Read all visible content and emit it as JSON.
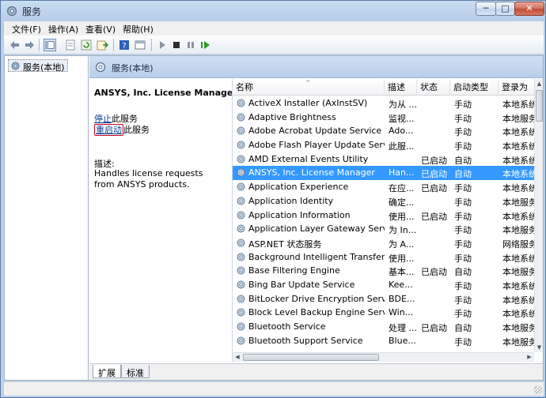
{
  "window": {
    "title": "服务"
  },
  "caption_buttons": {
    "minimize": "─",
    "maximize": "□",
    "close": "✕"
  },
  "menu": [
    {
      "label": "文件(F)"
    },
    {
      "label": "操作(A)"
    },
    {
      "label": "查看(V)"
    },
    {
      "label": "帮助(H)"
    }
  ],
  "toolbar": {
    "icons": [
      "back-arrow-icon",
      "forward-arrow-icon",
      "console-tree-icon",
      "properties-icon",
      "refresh-icon",
      "export-icon",
      "help-icon",
      "show-hide-icon",
      "play-icon",
      "stop-icon",
      "pause-icon",
      "restart-icon"
    ]
  },
  "tree": {
    "root_label": "服务(本地)"
  },
  "header": {
    "title": "服务(本地)"
  },
  "detail": {
    "service_title": "ANSYS, Inc. License Manager",
    "stop_link": "停止",
    "stop_suffix": "此服务",
    "restart_link": "重启动",
    "restart_suffix": "此服务",
    "desc_label": "描述:",
    "desc_text": "Handles license requests from ANSYS products."
  },
  "columns": {
    "name": "名称",
    "description": "描述",
    "status": "状态",
    "startup": "启动类型",
    "logon": "登录为"
  },
  "sort_indicator": "^",
  "services": [
    {
      "name": "ActiveX Installer (AxInstSV)",
      "desc": "为从 ...",
      "status": "",
      "startup": "手动",
      "logon": "本地系统"
    },
    {
      "name": "Adaptive Brightness",
      "desc": "监视...",
      "status": "",
      "startup": "手动",
      "logon": "本地服务"
    },
    {
      "name": "Adobe Acrobat Update Service",
      "desc": "Ado...",
      "status": "",
      "startup": "手动",
      "logon": "本地系统"
    },
    {
      "name": "Adobe Flash Player Update Servi...",
      "desc": "此服...",
      "status": "",
      "startup": "手动",
      "logon": "本地系统"
    },
    {
      "name": "AMD External Events Utility",
      "desc": "",
      "status": "已启动",
      "startup": "自动",
      "logon": "本地系统"
    },
    {
      "name": "ANSYS, Inc. License Manager",
      "desc": "Han...",
      "status": "已启动",
      "startup": "自动",
      "logon": "本地系统",
      "selected": true
    },
    {
      "name": "Application Experience",
      "desc": "在应...",
      "status": "已启动",
      "startup": "手动",
      "logon": "本地系统"
    },
    {
      "name": "Application Identity",
      "desc": "确定...",
      "status": "",
      "startup": "手动",
      "logon": "本地服务"
    },
    {
      "name": "Application Information",
      "desc": "使用...",
      "status": "已启动",
      "startup": "手动",
      "logon": "本地系统"
    },
    {
      "name": "Application Layer Gateway Service",
      "desc": "为 In...",
      "status": "",
      "startup": "手动",
      "logon": "本地服务"
    },
    {
      "name": "ASP.NET 状态服务",
      "desc": "为 A...",
      "status": "",
      "startup": "手动",
      "logon": "网络服务"
    },
    {
      "name": "Background Intelligent Transfer ...",
      "desc": "使用...",
      "status": "",
      "startup": "手动",
      "logon": "本地系统"
    },
    {
      "name": "Base Filtering Engine",
      "desc": "基本...",
      "status": "已启动",
      "startup": "自动",
      "logon": "本地服务"
    },
    {
      "name": "Bing Bar Update Service",
      "desc": "Kee...",
      "status": "",
      "startup": "手动",
      "logon": "本地系统"
    },
    {
      "name": "BitLocker Drive Encryption Service",
      "desc": "BDE...",
      "status": "",
      "startup": "手动",
      "logon": "本地系统"
    },
    {
      "name": "Block Level Backup Engine Service",
      "desc": "Win...",
      "status": "",
      "startup": "手动",
      "logon": "本地系统"
    },
    {
      "name": "Bluetooth Service",
      "desc": "处理 ...",
      "status": "已启动",
      "startup": "自动",
      "logon": "本地服务"
    },
    {
      "name": "Bluetooth Support Service",
      "desc": "Blue...",
      "status": "",
      "startup": "手动",
      "logon": "本地服务"
    }
  ],
  "tabs": [
    {
      "label": "扩展"
    },
    {
      "label": "标准"
    }
  ],
  "colors": {
    "selection": "#3399ff",
    "link": "#0b3f99",
    "restart_highlight": "#c9001b"
  }
}
